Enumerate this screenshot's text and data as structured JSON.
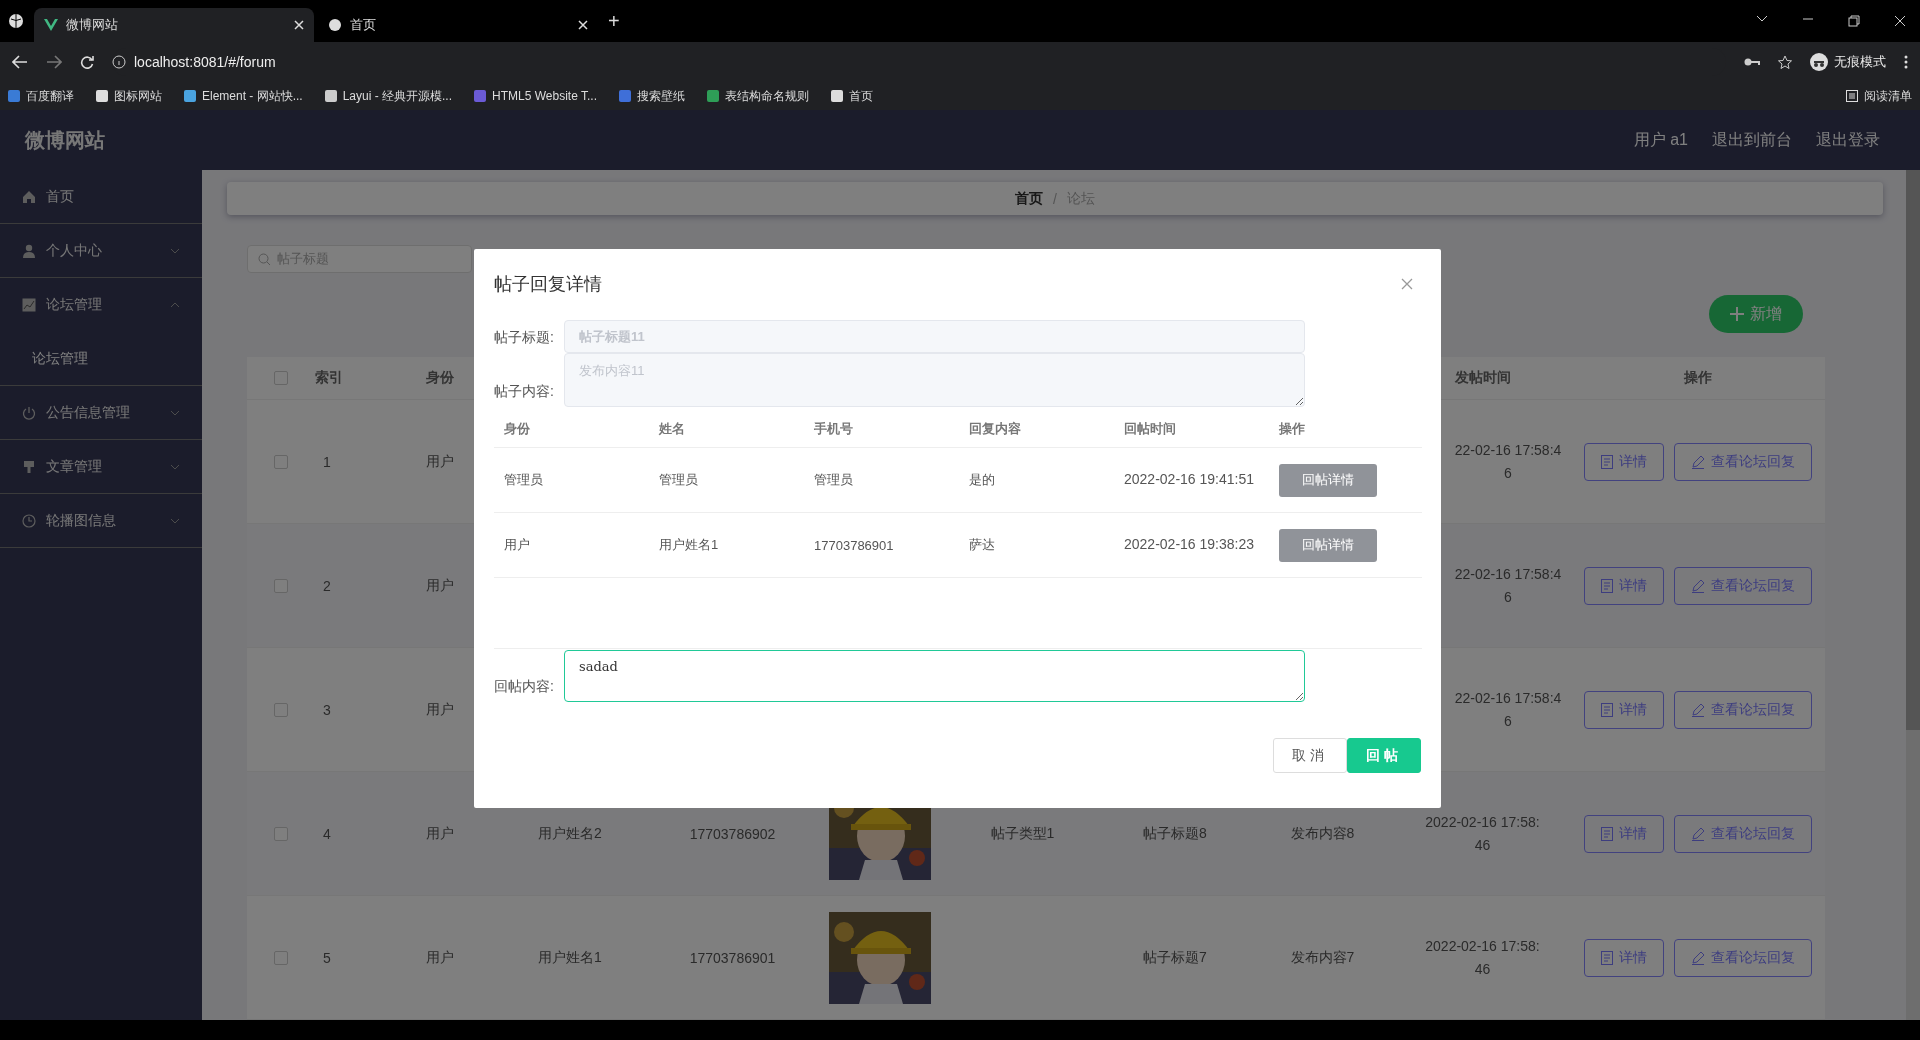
{
  "browser": {
    "tabs": [
      {
        "title": "微博网站",
        "selected": true
      },
      {
        "title": "首页",
        "selected": false
      }
    ],
    "new_tab": "+",
    "address": "localhost:8081/#/forum",
    "incognito": "无痕模式",
    "bookmarks": [
      "百度翻译",
      "图标网站",
      "Element - 网站快...",
      "Layui - 经典开源模...",
      "HTML5 Website T...",
      "搜索壁纸",
      "表结构命名规则",
      "首页"
    ],
    "reading_list": "阅读清单"
  },
  "header": {
    "logo": "微博网站",
    "links": [
      "用户 a1",
      "退出到前台",
      "退出登录"
    ]
  },
  "sidebar": {
    "items": [
      {
        "label": "首页",
        "kind": "link"
      },
      {
        "label": "个人中心",
        "kind": "menu",
        "expanded": false
      },
      {
        "label": "论坛管理",
        "kind": "menu",
        "expanded": true,
        "children": [
          {
            "label": "论坛管理"
          }
        ]
      },
      {
        "label": "公告信息管理",
        "kind": "menu",
        "expanded": false
      },
      {
        "label": "文章管理",
        "kind": "menu",
        "expanded": false
      },
      {
        "label": "轮播图信息",
        "kind": "menu",
        "expanded": false
      }
    ]
  },
  "breadcrumb": {
    "items": [
      "首页",
      "论坛"
    ],
    "separator": "/"
  },
  "search": {
    "placeholder": "帖子标题"
  },
  "add_button": "新增",
  "table": {
    "columns": {
      "index": "索引",
      "identity": "身份",
      "post_time": "发帖时间",
      "actions": "操作"
    },
    "header_checked": false,
    "rows": [
      {
        "checked": false,
        "index": "1",
        "identity": "用户",
        "post_time": "22-02-16 17:58:46",
        "actions": [
          "详情",
          "查看论坛回复"
        ]
      },
      {
        "checked": false,
        "index": "2",
        "identity": "用户",
        "post_time": "22-02-16 17:58:46",
        "actions": [
          "详情",
          "查看论坛回复"
        ]
      },
      {
        "checked": false,
        "index": "3",
        "identity": "用户",
        "post_time": "22-02-16 17:58:46",
        "actions": [
          "详情",
          "查看论坛回复"
        ]
      },
      {
        "checked": false,
        "index": "4",
        "identity": "用户",
        "name": "用户姓名2",
        "phone": "17703786902",
        "picture": {
          "kind": "picture"
        },
        "type": "帖子类型1",
        "title": "帖子标题8",
        "content": "发布内容8",
        "post_time": "2022-02-16 17:58:46",
        "actions": [
          "详情",
          "查看论坛回复"
        ]
      },
      {
        "checked": false,
        "index": "5",
        "identity": "用户",
        "name": "用户姓名1",
        "phone": "17703786901",
        "picture": {
          "kind": "picture"
        },
        "title": "帖子标题7",
        "content": "发布内容7",
        "post_time": "2022-02-16 17:58:46",
        "actions": [
          "详情",
          "查看论坛回复"
        ]
      }
    ]
  },
  "dialog": {
    "title": "帖子回复详情",
    "post_title": {
      "label": "帖子标题:",
      "value": "帖子标题11",
      "disabled": true
    },
    "post_content": {
      "label": "帖子内容:",
      "value": "发布内容11",
      "disabled": true
    },
    "replies": {
      "columns": [
        "身份",
        "姓名",
        "手机号",
        "回复内容",
        "回帖时间",
        "操作"
      ],
      "rows": [
        {
          "cells": [
            "管理员",
            "管理员",
            "管理员",
            "是的",
            "2022-02-16 19:41:51"
          ],
          "action": "回帖详情"
        },
        {
          "cells": [
            "用户",
            "用户姓名1",
            "17703786901",
            "萨达",
            "2022-02-16 19:38:23"
          ],
          "action": "回帖详情"
        }
      ]
    },
    "reply": {
      "label": "回帖内容:",
      "value": "sadad",
      "focused": true
    },
    "buttons": [
      {
        "label": "取消",
        "kind": "secondary"
      },
      {
        "label": "回帖",
        "kind": "primary"
      }
    ]
  }
}
